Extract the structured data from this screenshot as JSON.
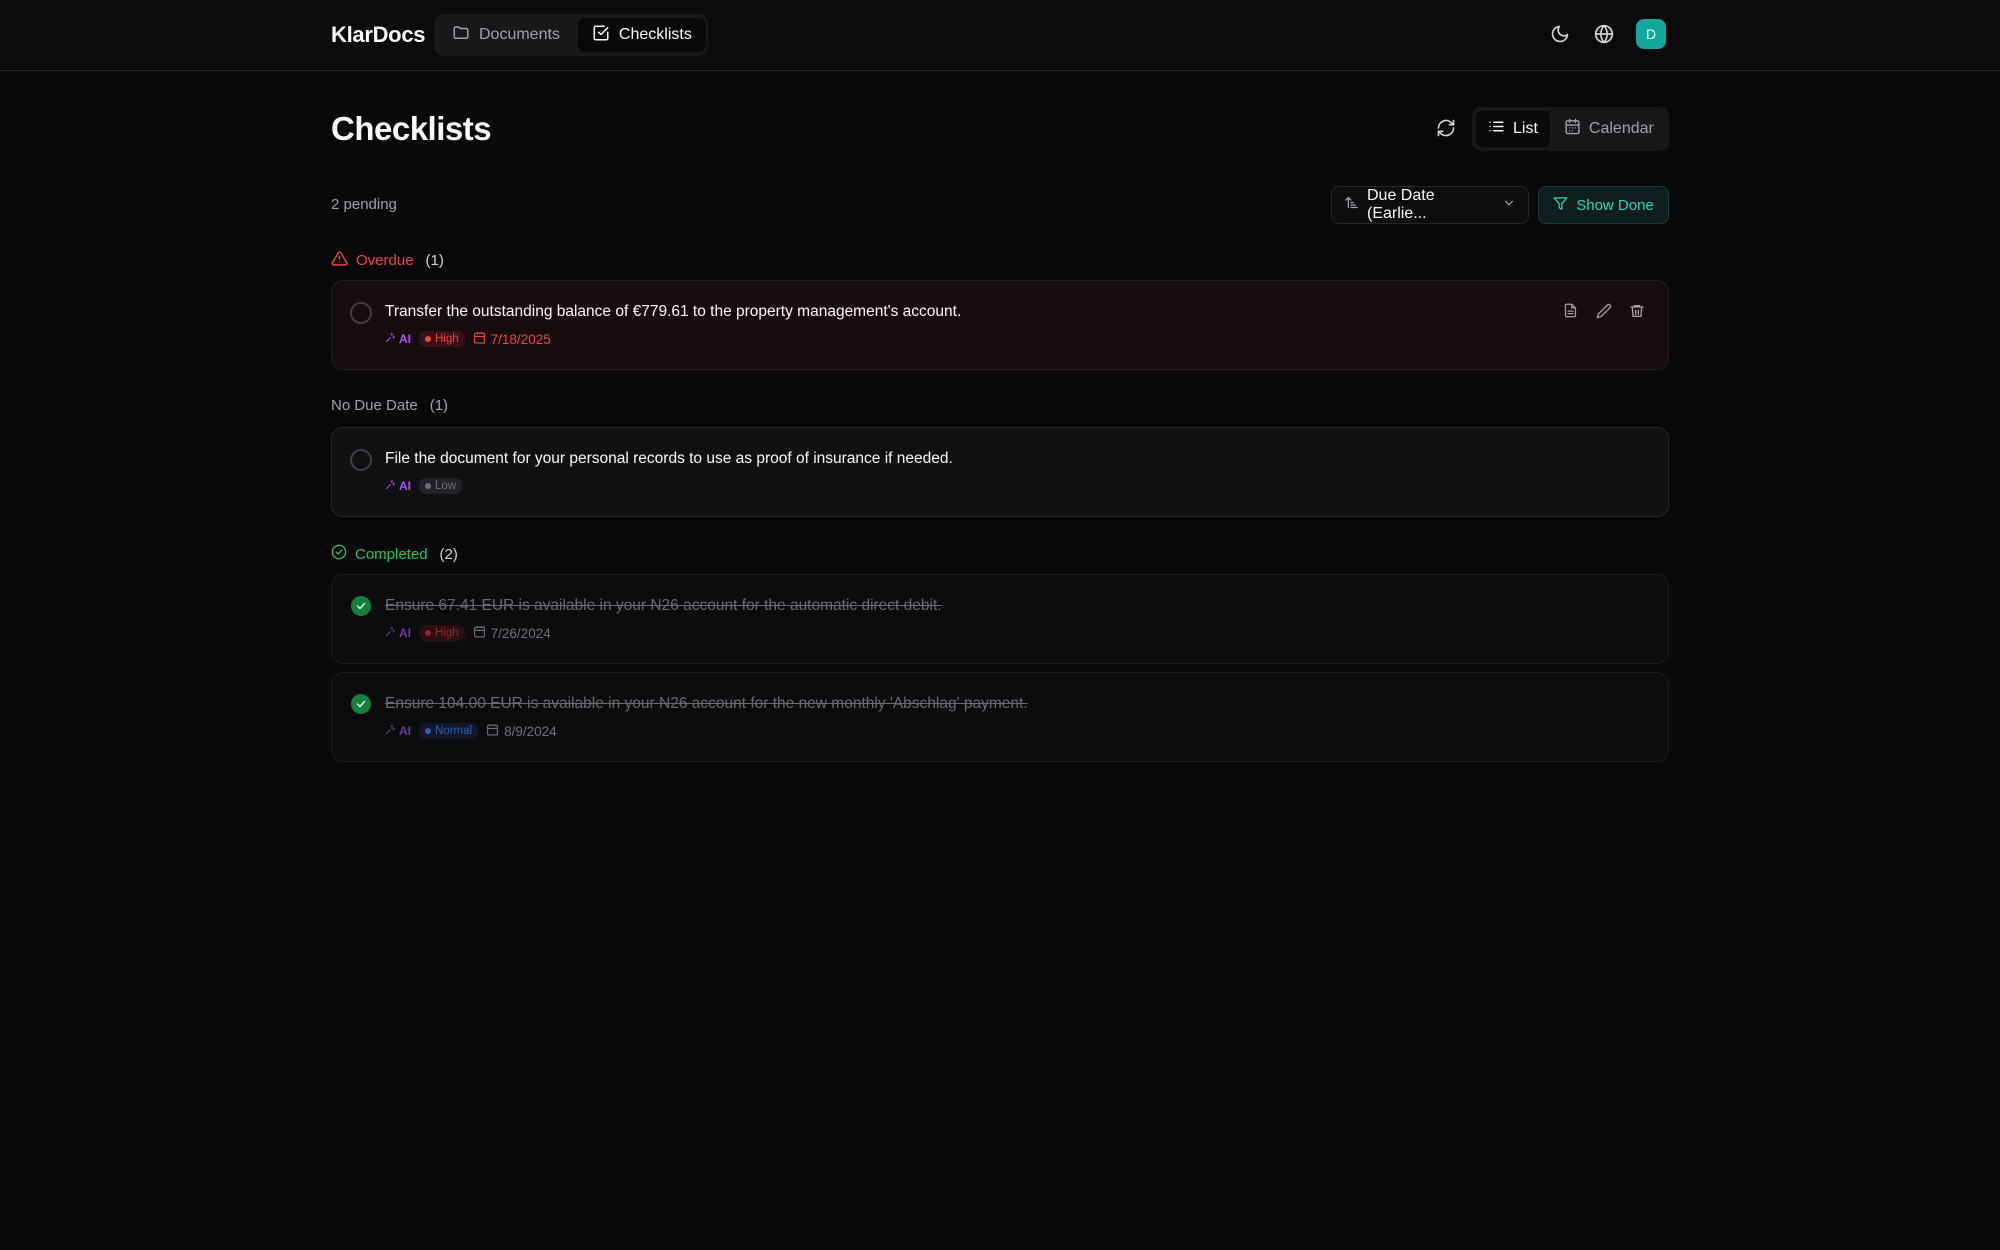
{
  "header": {
    "brand": "KlarDocs",
    "nav": [
      {
        "label": "Documents",
        "icon": "folder-icon"
      },
      {
        "label": "Checklists",
        "icon": "checkbox-icon",
        "active": true
      }
    ],
    "avatar_initial": "D"
  },
  "page": {
    "title": "Checklists",
    "view_toggle": [
      {
        "label": "List",
        "active": true
      },
      {
        "label": "Calendar"
      }
    ],
    "pending_text": "2 pending",
    "sort_label": "Due Date (Earlie...",
    "show_done_label": "Show Done"
  },
  "sections": {
    "overdue": {
      "label": "Overdue",
      "count": "(1)"
    },
    "no_due": {
      "label": "No Due Date",
      "count": "(1)"
    },
    "completed": {
      "label": "Completed",
      "count": "(2)"
    }
  },
  "items": {
    "overdue_0": {
      "title": "Transfer the outstanding balance of €779.61 to the property management's account.",
      "ai": "AI",
      "priority": "High",
      "date": "7/18/2025"
    },
    "nodue_0": {
      "title": "File the document for your personal records to use as proof of insurance if needed.",
      "ai": "AI",
      "priority": "Low"
    },
    "done_0": {
      "title": "Ensure 67.41 EUR is available in your N26 account for the automatic direct debit.",
      "ai": "AI",
      "priority": "High",
      "date": "7/26/2024"
    },
    "done_1": {
      "title": "Ensure 104.00 EUR is available in your N26 account for the new monthly 'Abschlag' payment.",
      "ai": "AI",
      "priority": "Normal",
      "date": "8/9/2024"
    }
  },
  "colors": {
    "accent": "#14a89a",
    "danger": "#ef4444",
    "success": "#22c55e",
    "ai": "#a855f7"
  }
}
